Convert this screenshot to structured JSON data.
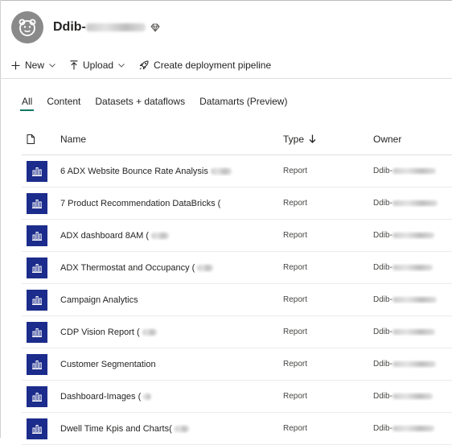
{
  "workspace": {
    "title_prefix": "Ddib-"
  },
  "toolbar": {
    "new_label": "New",
    "upload_label": "Upload",
    "pipeline_label": "Create deployment pipeline"
  },
  "tabs": [
    {
      "label": "All"
    },
    {
      "label": "Content"
    },
    {
      "label": "Datasets + dataflows"
    },
    {
      "label": "Datamarts (Preview)"
    }
  ],
  "columns": {
    "name": "Name",
    "type": "Type",
    "owner": "Owner"
  },
  "rows": [
    {
      "name": "6 ADX Website Bounce Rate Analysis",
      "type": "Report",
      "owner": "Ddib-"
    },
    {
      "name": "7 Product Recommendation DataBricks (",
      "type": "Report",
      "owner": "Ddib-"
    },
    {
      "name": "ADX dashboard 8AM (",
      "type": "Report",
      "owner": "Ddib-"
    },
    {
      "name": "ADX Thermostat and Occupancy (",
      "type": "Report",
      "owner": "Ddib-"
    },
    {
      "name": "Campaign Analytics",
      "type": "Report",
      "owner": "Ddib-"
    },
    {
      "name": "CDP Vision Report (",
      "type": "Report",
      "owner": "Ddib-"
    },
    {
      "name": "Customer Segmentation",
      "type": "Report",
      "owner": "Ddib-"
    },
    {
      "name": "Dashboard-Images (",
      "type": "Report",
      "owner": "Ddib-"
    },
    {
      "name": "Dwell Time Kpis and Charts(",
      "type": "Report",
      "owner": "Ddib-"
    }
  ],
  "colors": {
    "accent": "#117865",
    "report_tile": "#1c2c8c"
  }
}
